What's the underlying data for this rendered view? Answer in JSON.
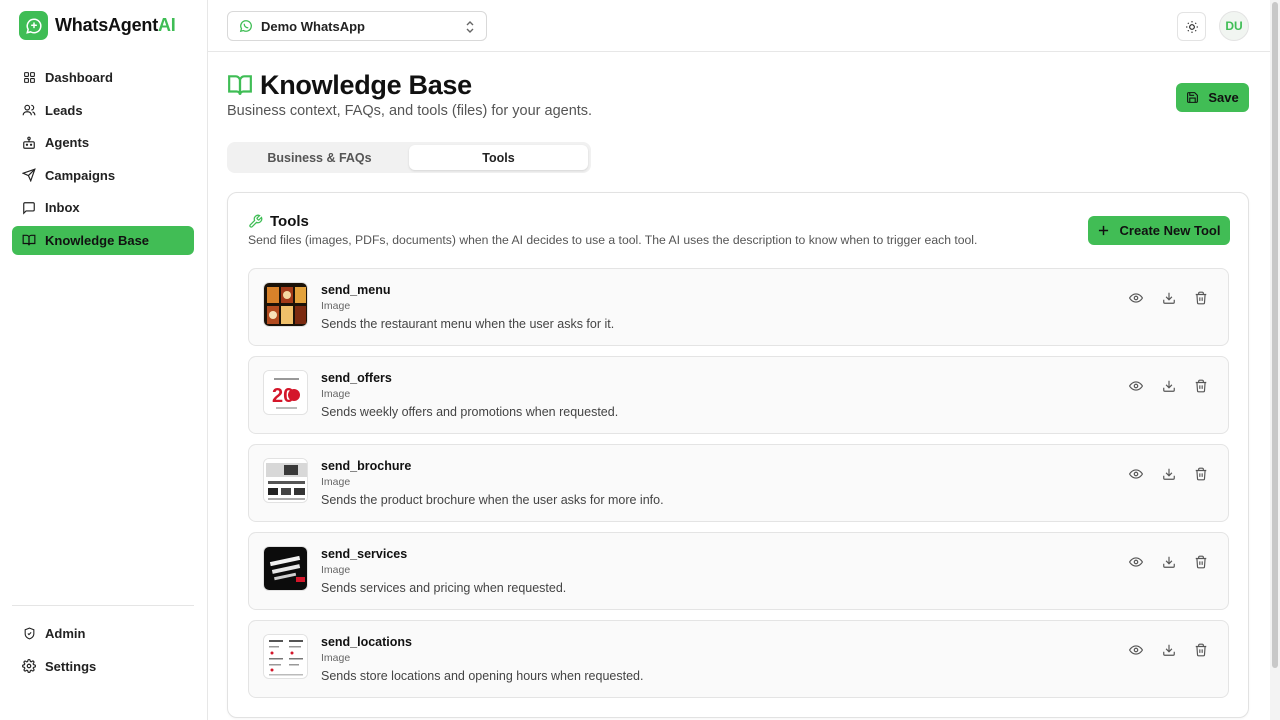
{
  "brand": {
    "name_main": "WhatsAgent",
    "name_accent": "AI"
  },
  "colors": {
    "accent": "#41bd55",
    "text": "#111111",
    "muted": "#555555"
  },
  "sidebar": {
    "items": [
      {
        "label": "Dashboard",
        "icon": "dashboard-icon"
      },
      {
        "label": "Leads",
        "icon": "users-icon"
      },
      {
        "label": "Agents",
        "icon": "bot-icon"
      },
      {
        "label": "Campaigns",
        "icon": "send-icon"
      },
      {
        "label": "Inbox",
        "icon": "message-icon"
      },
      {
        "label": "Knowledge Base",
        "icon": "book-icon",
        "active": true
      }
    ],
    "bottom_items": [
      {
        "label": "Admin",
        "icon": "shield-icon"
      },
      {
        "label": "Settings",
        "icon": "gear-icon"
      }
    ]
  },
  "topbar": {
    "account_select": "Demo WhatsApp",
    "avatar_initials": "DU"
  },
  "page": {
    "title": "Knowledge Base",
    "subtitle": "Business context, FAQs, and tools (files) for your agents.",
    "save_label": "Save"
  },
  "tabs": [
    {
      "label": "Business & FAQs",
      "active": false
    },
    {
      "label": "Tools",
      "active": true
    }
  ],
  "tools_card": {
    "title": "Tools",
    "description": "Send files (images, PDFs, documents) when the AI decides to use a tool. The AI uses the description to know when to trigger each tool.",
    "create_label": "Create New Tool",
    "items": [
      {
        "name": "send_menu",
        "type": "Image",
        "description": "Sends the restaurant menu when the user asks for it."
      },
      {
        "name": "send_offers",
        "type": "Image",
        "description": "Sends weekly offers and promotions when requested."
      },
      {
        "name": "send_brochure",
        "type": "Image",
        "description": "Sends the product brochure when the user asks for more info."
      },
      {
        "name": "send_services",
        "type": "Image",
        "description": "Sends services and pricing when requested."
      },
      {
        "name": "send_locations",
        "type": "Image",
        "description": "Sends store locations and opening hours when requested."
      }
    ]
  }
}
